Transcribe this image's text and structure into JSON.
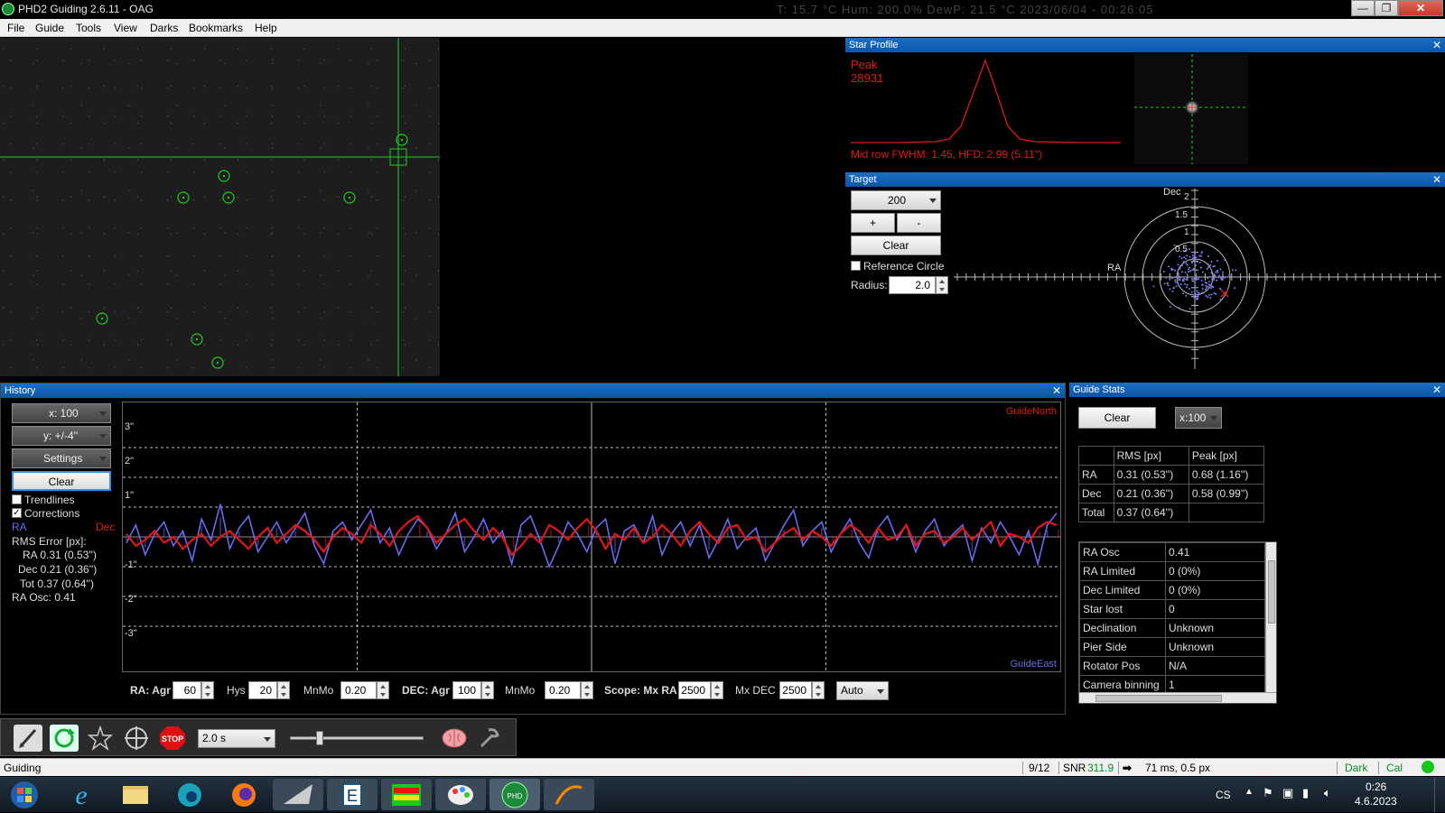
{
  "window": {
    "title": "PHD2 Guiding 2.6.11 - OAG",
    "ghost_text": "T: 15.7 °C   Hum: 200.0%   DewP: 21.5 °C   2023/06/04 - 00:26:05"
  },
  "menu": [
    "File",
    "Guide",
    "Tools",
    "View",
    "Darks",
    "Bookmarks",
    "Help"
  ],
  "star_profile": {
    "title": "Star Profile",
    "peak_label": "Peak",
    "peak_value": "28931",
    "fwhm_text": "Mid row FWHM: 1.45, HFD: 2.99 (5.11\")"
  },
  "target": {
    "title": "Target",
    "scale_value": "200",
    "plus_label": "+",
    "minus_label": "-",
    "clear_label": "Clear",
    "reference_circle_label": "Reference Circle",
    "radius_label": "Radius:",
    "radius_value": "2.0",
    "dec_axis_label": "Dec",
    "ra_axis_label": "RA",
    "ring_labels": [
      "2",
      "1.5",
      "1",
      "0.5"
    ]
  },
  "history": {
    "title": "History",
    "x_scale": "x: 100",
    "y_scale": "y: +/-4''",
    "settings_label": "Settings",
    "clear_label": "Clear",
    "trendlines_label": "Trendlines",
    "corrections_label": "Corrections",
    "ra_legend": "RA",
    "dec_legend": "Dec",
    "rms_header": "RMS Error [px]:",
    "rms_ra": "RA 0.31 (0.53'')",
    "rms_dec": "Dec 0.21 (0.36'')",
    "rms_tot": "Tot 0.37 (0.64'')",
    "ra_osc": "RA Osc: 0.41",
    "guide_north": "GuideNorth",
    "guide_east": "GuideEast",
    "y_ticks": [
      "3\"",
      "2\"",
      "1\"",
      "-1\"",
      "-2\"",
      "-3\""
    ],
    "params": {
      "ra_label": "RA: Agr",
      "ra_agr": "60",
      "hys_label": "Hys",
      "hys": "20",
      "mnmo_label": "MnMo",
      "ra_mnmo": "0.20",
      "dec_label": "DEC: Agr",
      "dec_agr": "100",
      "dec_mnmo_label": "MnMo",
      "dec_mnmo": "0.20",
      "scope_label": "Scope: Mx RA",
      "mx_ra": "2500",
      "mx_dec_label": "Mx DEC",
      "mx_dec": "2500",
      "dec_mode": "Auto"
    }
  },
  "chart_data": {
    "type": "line",
    "title": "",
    "ylim": [
      -4,
      4
    ],
    "series": [
      {
        "name": "RA",
        "color": "#6a6af0",
        "values": [
          -0.2,
          0.4,
          -0.6,
          0.1,
          0.5,
          -0.3,
          0.2,
          -0.8,
          0.6,
          -0.1,
          1.1,
          -0.4,
          0.3,
          0.7,
          -0.5,
          0.0,
          0.5,
          -0.2,
          0.3,
          0.8,
          -0.3,
          -0.9,
          0.2,
          0.5,
          -0.1,
          0.4,
          0.9,
          -0.2,
          0.3,
          -0.6,
          0.1,
          0.6,
          0.3,
          -0.4,
          0.1,
          0.8,
          -0.5,
          0.0,
          0.6,
          -0.2,
          0.2,
          -0.9,
          0.4,
          0.7,
          -0.1,
          -1.0,
          -0.3,
          0.5,
          0.1,
          -0.5,
          0.3,
          0.6,
          -0.9,
          0.2,
          0.4,
          -0.2,
          0.7,
          -0.6,
          0.1,
          0.5,
          -0.3,
          0.4,
          -0.7,
          -0.1,
          0.6,
          -0.4,
          0.0,
          0.3,
          -0.8,
          -0.2,
          0.4,
          0.9,
          -0.3,
          0.2,
          0.5,
          -0.5,
          0.1,
          0.6,
          -0.2,
          -0.7,
          0.3,
          0.7,
          -0.1,
          0.4,
          -0.5,
          0.2,
          0.6,
          -0.3,
          0.1,
          0.4,
          -0.8,
          0.3,
          -0.2,
          0.5,
          0.0,
          -0.6,
          0.2,
          -0.9,
          0.4,
          0.8
        ]
      },
      {
        "name": "Dec",
        "color": "#e01818",
        "values": [
          0.1,
          -0.3,
          -0.1,
          0.2,
          -0.2,
          0.0,
          -0.4,
          -0.1,
          0.1,
          -0.3,
          0.0,
          0.2,
          -0.1,
          -0.4,
          0.0,
          0.3,
          -0.2,
          0.1,
          0.4,
          0.2,
          -0.1,
          -0.5,
          0.0,
          0.3,
          0.1,
          -0.2,
          0.4,
          0.1,
          -0.3,
          0.2,
          0.5,
          0.7,
          0.3,
          -0.2,
          0.1,
          0.4,
          0.6,
          0.2,
          -0.1,
          0.3,
          0.0,
          -0.6,
          -0.3,
          0.1,
          -0.2,
          0.4,
          0.2,
          -0.1,
          0.3,
          0.6,
          0.2,
          -0.4,
          0.1,
          -0.1,
          0.3,
          -0.2,
          0.0,
          0.4,
          0.1,
          -0.3,
          0.2,
          0.5,
          0.1,
          -0.2,
          0.3,
          0.4,
          -0.1,
          0.0,
          -0.5,
          -0.2,
          0.1,
          0.3,
          -0.1,
          0.2,
          0.0,
          -0.3,
          0.1,
          0.4,
          0.2,
          -0.2,
          0.3,
          -0.1,
          0.0,
          0.4,
          -0.3,
          0.1,
          0.2,
          -0.2,
          0.0,
          0.3,
          -0.1,
          0.2,
          0.5,
          -0.3,
          0.1,
          0.0,
          -0.2,
          0.3,
          0.5,
          0.4
        ]
      }
    ]
  },
  "guide_stats": {
    "title": "Guide Stats",
    "clear_label": "Clear",
    "scale": "x:100",
    "headers": [
      "",
      "RMS [px]",
      "Peak [px]"
    ],
    "rows": [
      [
        "RA",
        "0.31 (0.53'')",
        "0.68 (1.16'')"
      ],
      [
        "Dec",
        "0.21 (0.36'')",
        "0.58 (0.99'')"
      ],
      [
        "Total",
        "0.37 (0.64'')",
        ""
      ]
    ],
    "info": [
      [
        "RA Osc",
        "0.41"
      ],
      [
        "RA Limited",
        "0 (0%)"
      ],
      [
        "Dec Limited",
        "0 (0%)"
      ],
      [
        "Star lost",
        "0"
      ],
      [
        "Declination",
        "Unknown"
      ],
      [
        "Pier Side",
        "Unknown"
      ],
      [
        "Rotator Pos",
        "N/A"
      ],
      [
        "Camera binning",
        "1"
      ]
    ]
  },
  "toolbar": {
    "exposure": "2.0 s",
    "stop_label": "STOP"
  },
  "status": {
    "state": "Guiding",
    "frames": "9/12",
    "snr_label": "SNR",
    "snr_value": "311.9",
    "guide_pulse": "71 ms, 0.5 px",
    "dark": "Dark",
    "cal": "Cal"
  },
  "taskbar": {
    "lang": "CS",
    "time": "0:26",
    "date": "4.6.2023"
  }
}
